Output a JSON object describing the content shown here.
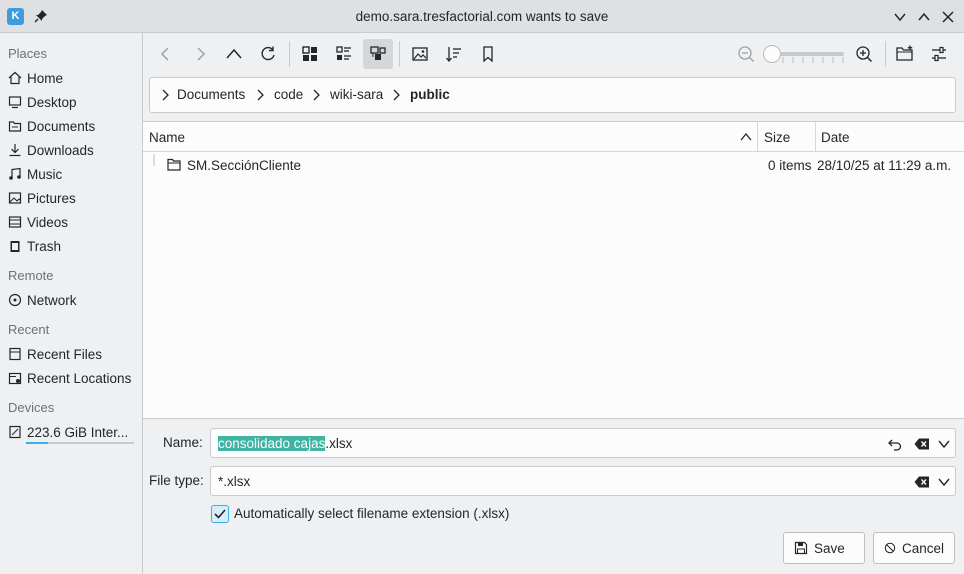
{
  "window": {
    "title": "demo.sara.tresfactorial.com wants to save",
    "app_icon_label": "K"
  },
  "sidebar": {
    "sections": [
      {
        "heading": "Places",
        "items": [
          {
            "label": "Home",
            "icon": "home-icon"
          },
          {
            "label": "Desktop",
            "icon": "desktop-icon"
          },
          {
            "label": "Documents",
            "icon": "documents-icon"
          },
          {
            "label": "Downloads",
            "icon": "downloads-icon"
          },
          {
            "label": "Music",
            "icon": "music-icon"
          },
          {
            "label": "Pictures",
            "icon": "pictures-icon"
          },
          {
            "label": "Videos",
            "icon": "videos-icon"
          },
          {
            "label": "Trash",
            "icon": "trash-icon"
          }
        ]
      },
      {
        "heading": "Remote",
        "items": [
          {
            "label": "Network",
            "icon": "network-icon"
          }
        ]
      },
      {
        "heading": "Recent",
        "items": [
          {
            "label": "Recent Files",
            "icon": "recent-files-icon"
          },
          {
            "label": "Recent Locations",
            "icon": "recent-locations-icon"
          }
        ]
      },
      {
        "heading": "Devices",
        "items": [
          {
            "label": "223.6 GiB Inter...",
            "icon": "drive-icon",
            "usage_fraction": 0.2
          }
        ]
      }
    ]
  },
  "breadcrumb": {
    "segments": [
      "Documents",
      "code",
      "wiki-sara",
      "public"
    ]
  },
  "list": {
    "columns": {
      "name": "Name",
      "size": "Size",
      "date": "Date"
    },
    "sort_column": "Name",
    "rows": [
      {
        "name": "SM.SecciónCliente",
        "size": "0 items",
        "date": "28/10/25 at 11:29 a.m.",
        "icon": "folder-icon"
      }
    ]
  },
  "form": {
    "name_label": "Name:",
    "name_selected": "consolidado cajas",
    "name_rest": ".xlsx",
    "filetype_label": "File type:",
    "filetype_value": "*.xlsx",
    "auto_ext_label": "Automatically select filename extension (.xlsx)",
    "auto_ext_checked": true
  },
  "buttons": {
    "save": "Save",
    "cancel": "Cancel"
  },
  "colors": {
    "accent": "#3daee9",
    "selection": "#41b3a3"
  }
}
